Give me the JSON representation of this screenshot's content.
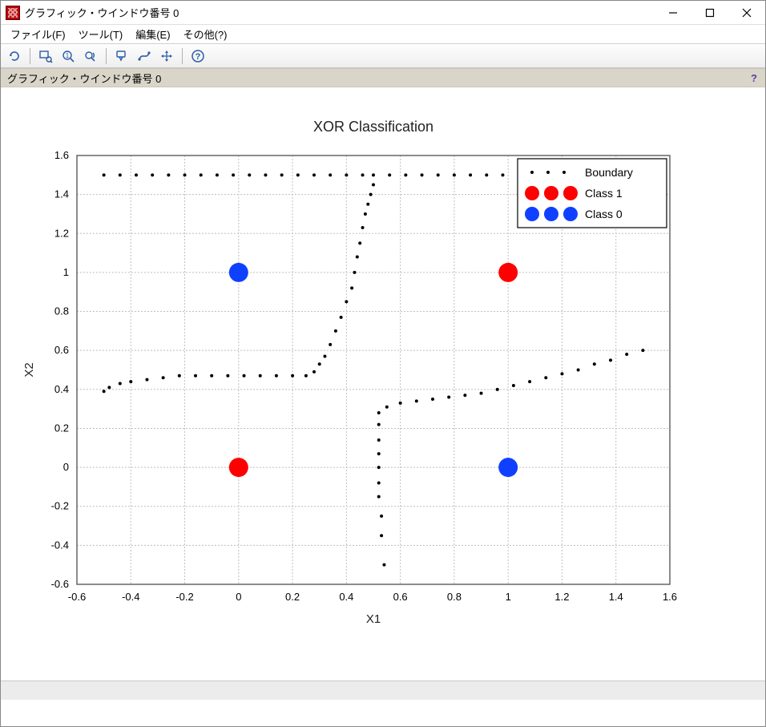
{
  "window": {
    "title": "グラフィック・ウインドウ番号 0"
  },
  "menu": {
    "file": "ファイル(F)",
    "tools": "ツール(T)",
    "edit": "編集(E)",
    "other": "その他(?)"
  },
  "infobar": {
    "label": "グラフィック・ウインドウ番号 0",
    "help": "?"
  },
  "chart_data": {
    "type": "scatter",
    "title": "XOR Classification",
    "xlabel": "X1",
    "ylabel": "X2",
    "xlim": [
      -0.6,
      1.6
    ],
    "ylim": [
      -0.6,
      1.6
    ],
    "xticks": [
      -0.6,
      -0.4,
      -0.2,
      0,
      0.2,
      0.4,
      0.6,
      0.8,
      1.0,
      1.2,
      1.4,
      1.6
    ],
    "yticks": [
      -0.6,
      -0.4,
      -0.2,
      0,
      0.2,
      0.4,
      0.6,
      0.8,
      1.0,
      1.2,
      1.4,
      1.6
    ],
    "legend": {
      "position": "upper-right",
      "entries": [
        {
          "label": "Boundary",
          "marker": "dot",
          "color": "#000000"
        },
        {
          "label": "Class 1",
          "marker": "circle",
          "color": "#ff0000"
        },
        {
          "label": "Class 0",
          "marker": "circle",
          "color": "#1040ff"
        }
      ]
    },
    "series": [
      {
        "name": "Class 1",
        "marker": "circle",
        "color": "#ff0000",
        "points": [
          {
            "x": 0,
            "y": 0
          },
          {
            "x": 1,
            "y": 1
          }
        ]
      },
      {
        "name": "Class 0",
        "marker": "circle",
        "color": "#1040ff",
        "points": [
          {
            "x": 0,
            "y": 1
          },
          {
            "x": 1,
            "y": 0
          }
        ]
      },
      {
        "name": "Boundary",
        "marker": "dot",
        "color": "#000000",
        "points": [
          {
            "x": -0.5,
            "y": 1.5
          },
          {
            "x": -0.44,
            "y": 1.5
          },
          {
            "x": -0.38,
            "y": 1.5
          },
          {
            "x": -0.32,
            "y": 1.5
          },
          {
            "x": -0.26,
            "y": 1.5
          },
          {
            "x": -0.2,
            "y": 1.5
          },
          {
            "x": -0.14,
            "y": 1.5
          },
          {
            "x": -0.08,
            "y": 1.5
          },
          {
            "x": -0.02,
            "y": 1.5
          },
          {
            "x": 0.04,
            "y": 1.5
          },
          {
            "x": 0.1,
            "y": 1.5
          },
          {
            "x": 0.16,
            "y": 1.5
          },
          {
            "x": 0.22,
            "y": 1.5
          },
          {
            "x": 0.28,
            "y": 1.5
          },
          {
            "x": 0.34,
            "y": 1.5
          },
          {
            "x": 0.4,
            "y": 1.5
          },
          {
            "x": 0.46,
            "y": 1.5
          },
          {
            "x": 0.5,
            "y": 1.5
          },
          {
            "x": 0.5,
            "y": 1.45
          },
          {
            "x": 0.49,
            "y": 1.4
          },
          {
            "x": 0.48,
            "y": 1.35
          },
          {
            "x": 0.47,
            "y": 1.3
          },
          {
            "x": 0.46,
            "y": 1.23
          },
          {
            "x": 0.45,
            "y": 1.15
          },
          {
            "x": 0.44,
            "y": 1.08
          },
          {
            "x": 0.43,
            "y": 1.0
          },
          {
            "x": 0.42,
            "y": 0.92
          },
          {
            "x": 0.4,
            "y": 0.85
          },
          {
            "x": 0.38,
            "y": 0.77
          },
          {
            "x": 0.36,
            "y": 0.7
          },
          {
            "x": 0.34,
            "y": 0.63
          },
          {
            "x": 0.32,
            "y": 0.57
          },
          {
            "x": 0.3,
            "y": 0.53
          },
          {
            "x": 0.28,
            "y": 0.49
          },
          {
            "x": 0.25,
            "y": 0.47
          },
          {
            "x": 0.2,
            "y": 0.47
          },
          {
            "x": 0.14,
            "y": 0.47
          },
          {
            "x": 0.08,
            "y": 0.47
          },
          {
            "x": 0.02,
            "y": 0.47
          },
          {
            "x": -0.04,
            "y": 0.47
          },
          {
            "x": -0.1,
            "y": 0.47
          },
          {
            "x": -0.16,
            "y": 0.47
          },
          {
            "x": -0.22,
            "y": 0.47
          },
          {
            "x": -0.28,
            "y": 0.46
          },
          {
            "x": -0.34,
            "y": 0.45
          },
          {
            "x": -0.4,
            "y": 0.44
          },
          {
            "x": -0.44,
            "y": 0.43
          },
          {
            "x": -0.48,
            "y": 0.41
          },
          {
            "x": -0.5,
            "y": 0.39
          },
          {
            "x": 0.56,
            "y": 1.5
          },
          {
            "x": 0.62,
            "y": 1.5
          },
          {
            "x": 0.68,
            "y": 1.5
          },
          {
            "x": 0.74,
            "y": 1.5
          },
          {
            "x": 0.8,
            "y": 1.5
          },
          {
            "x": 0.86,
            "y": 1.5
          },
          {
            "x": 0.92,
            "y": 1.5
          },
          {
            "x": 0.98,
            "y": 1.5
          },
          {
            "x": 1.04,
            "y": 1.5
          },
          {
            "x": 1.1,
            "y": 1.5
          },
          {
            "x": 1.16,
            "y": 1.5
          },
          {
            "x": 1.22,
            "y": 1.5
          },
          {
            "x": 1.28,
            "y": 1.5
          },
          {
            "x": 1.34,
            "y": 1.5
          },
          {
            "x": 1.4,
            "y": 1.5
          },
          {
            "x": 1.46,
            "y": 1.5
          },
          {
            "x": 1.5,
            "y": 1.5
          },
          {
            "x": 0.52,
            "y": 0.28
          },
          {
            "x": 0.55,
            "y": 0.31
          },
          {
            "x": 0.6,
            "y": 0.33
          },
          {
            "x": 0.66,
            "y": 0.34
          },
          {
            "x": 0.72,
            "y": 0.35
          },
          {
            "x": 0.78,
            "y": 0.36
          },
          {
            "x": 0.84,
            "y": 0.37
          },
          {
            "x": 0.9,
            "y": 0.38
          },
          {
            "x": 0.96,
            "y": 0.4
          },
          {
            "x": 1.02,
            "y": 0.42
          },
          {
            "x": 1.08,
            "y": 0.44
          },
          {
            "x": 1.14,
            "y": 0.46
          },
          {
            "x": 1.2,
            "y": 0.48
          },
          {
            "x": 1.26,
            "y": 0.5
          },
          {
            "x": 1.32,
            "y": 0.53
          },
          {
            "x": 1.38,
            "y": 0.55
          },
          {
            "x": 1.44,
            "y": 0.58
          },
          {
            "x": 1.5,
            "y": 0.6
          },
          {
            "x": 0.52,
            "y": 0.22
          },
          {
            "x": 0.52,
            "y": 0.14
          },
          {
            "x": 0.52,
            "y": 0.07
          },
          {
            "x": 0.52,
            "y": 0.0
          },
          {
            "x": 0.52,
            "y": -0.08
          },
          {
            "x": 0.52,
            "y": -0.15
          },
          {
            "x": 0.53,
            "y": -0.25
          },
          {
            "x": 0.53,
            "y": -0.35
          },
          {
            "x": 0.54,
            "y": -0.5
          }
        ]
      }
    ]
  }
}
